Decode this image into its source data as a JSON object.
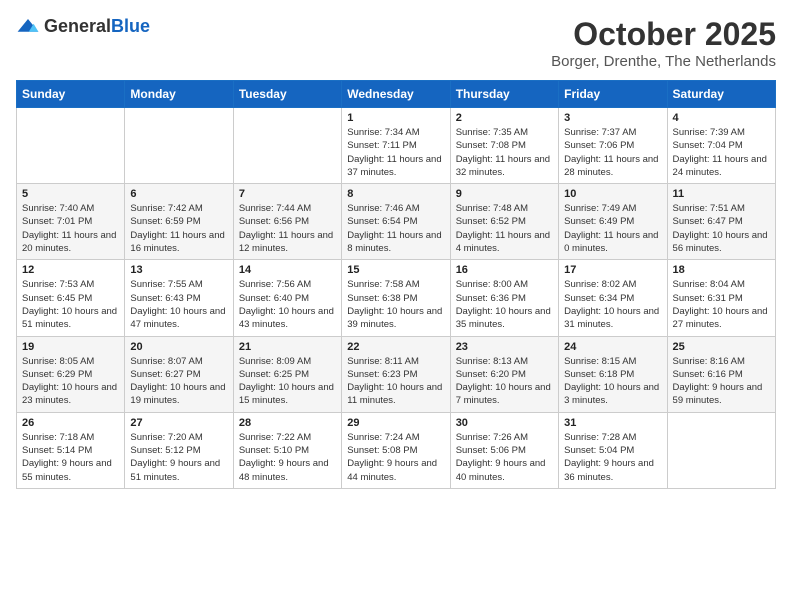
{
  "header": {
    "logo_general": "General",
    "logo_blue": "Blue",
    "month": "October 2025",
    "location": "Borger, Drenthe, The Netherlands"
  },
  "weekdays": [
    "Sunday",
    "Monday",
    "Tuesday",
    "Wednesday",
    "Thursday",
    "Friday",
    "Saturday"
  ],
  "weeks": [
    [
      {
        "day": "",
        "info": ""
      },
      {
        "day": "",
        "info": ""
      },
      {
        "day": "",
        "info": ""
      },
      {
        "day": "1",
        "info": "Sunrise: 7:34 AM\nSunset: 7:11 PM\nDaylight: 11 hours and 37 minutes."
      },
      {
        "day": "2",
        "info": "Sunrise: 7:35 AM\nSunset: 7:08 PM\nDaylight: 11 hours and 32 minutes."
      },
      {
        "day": "3",
        "info": "Sunrise: 7:37 AM\nSunset: 7:06 PM\nDaylight: 11 hours and 28 minutes."
      },
      {
        "day": "4",
        "info": "Sunrise: 7:39 AM\nSunset: 7:04 PM\nDaylight: 11 hours and 24 minutes."
      }
    ],
    [
      {
        "day": "5",
        "info": "Sunrise: 7:40 AM\nSunset: 7:01 PM\nDaylight: 11 hours and 20 minutes."
      },
      {
        "day": "6",
        "info": "Sunrise: 7:42 AM\nSunset: 6:59 PM\nDaylight: 11 hours and 16 minutes."
      },
      {
        "day": "7",
        "info": "Sunrise: 7:44 AM\nSunset: 6:56 PM\nDaylight: 11 hours and 12 minutes."
      },
      {
        "day": "8",
        "info": "Sunrise: 7:46 AM\nSunset: 6:54 PM\nDaylight: 11 hours and 8 minutes."
      },
      {
        "day": "9",
        "info": "Sunrise: 7:48 AM\nSunset: 6:52 PM\nDaylight: 11 hours and 4 minutes."
      },
      {
        "day": "10",
        "info": "Sunrise: 7:49 AM\nSunset: 6:49 PM\nDaylight: 11 hours and 0 minutes."
      },
      {
        "day": "11",
        "info": "Sunrise: 7:51 AM\nSunset: 6:47 PM\nDaylight: 10 hours and 56 minutes."
      }
    ],
    [
      {
        "day": "12",
        "info": "Sunrise: 7:53 AM\nSunset: 6:45 PM\nDaylight: 10 hours and 51 minutes."
      },
      {
        "day": "13",
        "info": "Sunrise: 7:55 AM\nSunset: 6:43 PM\nDaylight: 10 hours and 47 minutes."
      },
      {
        "day": "14",
        "info": "Sunrise: 7:56 AM\nSunset: 6:40 PM\nDaylight: 10 hours and 43 minutes."
      },
      {
        "day": "15",
        "info": "Sunrise: 7:58 AM\nSunset: 6:38 PM\nDaylight: 10 hours and 39 minutes."
      },
      {
        "day": "16",
        "info": "Sunrise: 8:00 AM\nSunset: 6:36 PM\nDaylight: 10 hours and 35 minutes."
      },
      {
        "day": "17",
        "info": "Sunrise: 8:02 AM\nSunset: 6:34 PM\nDaylight: 10 hours and 31 minutes."
      },
      {
        "day": "18",
        "info": "Sunrise: 8:04 AM\nSunset: 6:31 PM\nDaylight: 10 hours and 27 minutes."
      }
    ],
    [
      {
        "day": "19",
        "info": "Sunrise: 8:05 AM\nSunset: 6:29 PM\nDaylight: 10 hours and 23 minutes."
      },
      {
        "day": "20",
        "info": "Sunrise: 8:07 AM\nSunset: 6:27 PM\nDaylight: 10 hours and 19 minutes."
      },
      {
        "day": "21",
        "info": "Sunrise: 8:09 AM\nSunset: 6:25 PM\nDaylight: 10 hours and 15 minutes."
      },
      {
        "day": "22",
        "info": "Sunrise: 8:11 AM\nSunset: 6:23 PM\nDaylight: 10 hours and 11 minutes."
      },
      {
        "day": "23",
        "info": "Sunrise: 8:13 AM\nSunset: 6:20 PM\nDaylight: 10 hours and 7 minutes."
      },
      {
        "day": "24",
        "info": "Sunrise: 8:15 AM\nSunset: 6:18 PM\nDaylight: 10 hours and 3 minutes."
      },
      {
        "day": "25",
        "info": "Sunrise: 8:16 AM\nSunset: 6:16 PM\nDaylight: 9 hours and 59 minutes."
      }
    ],
    [
      {
        "day": "26",
        "info": "Sunrise: 7:18 AM\nSunset: 5:14 PM\nDaylight: 9 hours and 55 minutes."
      },
      {
        "day": "27",
        "info": "Sunrise: 7:20 AM\nSunset: 5:12 PM\nDaylight: 9 hours and 51 minutes."
      },
      {
        "day": "28",
        "info": "Sunrise: 7:22 AM\nSunset: 5:10 PM\nDaylight: 9 hours and 48 minutes."
      },
      {
        "day": "29",
        "info": "Sunrise: 7:24 AM\nSunset: 5:08 PM\nDaylight: 9 hours and 44 minutes."
      },
      {
        "day": "30",
        "info": "Sunrise: 7:26 AM\nSunset: 5:06 PM\nDaylight: 9 hours and 40 minutes."
      },
      {
        "day": "31",
        "info": "Sunrise: 7:28 AM\nSunset: 5:04 PM\nDaylight: 9 hours and 36 minutes."
      },
      {
        "day": "",
        "info": ""
      }
    ]
  ]
}
